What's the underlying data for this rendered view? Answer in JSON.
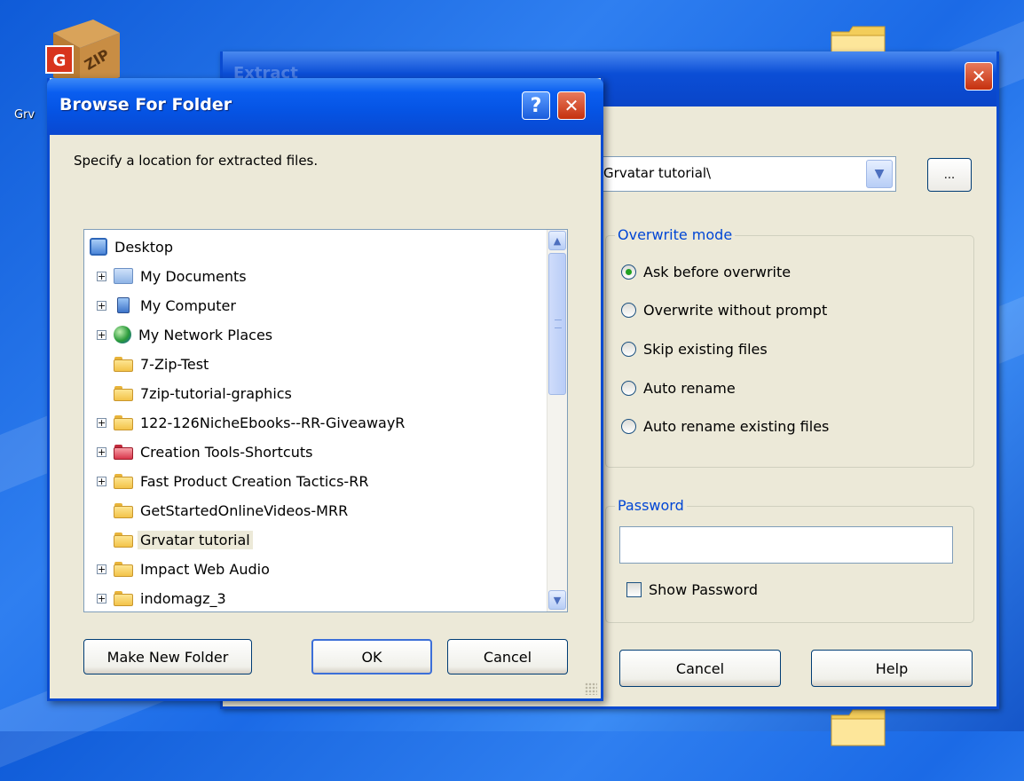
{
  "desktop": {
    "icon_label": "Grv",
    "zip_icon_text": "ZIP"
  },
  "extract_window": {
    "title": "Extract",
    "path_value": "\\Grvatar tutorial\\",
    "browse_label": "...",
    "overwrite_mode": {
      "legend": "Overwrite mode",
      "options": [
        {
          "label": "Ask before overwrite",
          "selected": true
        },
        {
          "label": "Overwrite without prompt",
          "selected": false
        },
        {
          "label": "Skip existing files",
          "selected": false
        },
        {
          "label": "Auto rename",
          "selected": false
        },
        {
          "label": "Auto rename existing files",
          "selected": false
        }
      ]
    },
    "password": {
      "legend": "Password",
      "value": "",
      "show_password_label": "Show Password",
      "show_password_checked": false
    },
    "cancel_label": "Cancel",
    "help_label": "Help"
  },
  "browse_dialog": {
    "title": "Browse For Folder",
    "help_glyph": "?",
    "prompt": "Specify a location for extracted files.",
    "tree": {
      "root": "Desktop",
      "items": [
        {
          "label": "My Documents",
          "expandable": true,
          "icon": "documents-icon"
        },
        {
          "label": "My Computer",
          "expandable": true,
          "icon": "computer-icon"
        },
        {
          "label": "My Network Places",
          "expandable": true,
          "icon": "network-icon"
        },
        {
          "label": "7-Zip-Test",
          "expandable": false,
          "icon": "folder-icon"
        },
        {
          "label": "7zip-tutorial-graphics",
          "expandable": false,
          "icon": "folder-icon"
        },
        {
          "label": "122-126NicheEbooks--RR-GiveawayR",
          "expandable": true,
          "icon": "folder-icon"
        },
        {
          "label": "Creation Tools-Shortcuts",
          "expandable": true,
          "icon": "red-folder-icon"
        },
        {
          "label": "Fast Product Creation Tactics-RR",
          "expandable": true,
          "icon": "folder-icon"
        },
        {
          "label": "GetStartedOnlineVideos-MRR",
          "expandable": false,
          "icon": "folder-icon"
        },
        {
          "label": "Grvatar tutorial",
          "expandable": false,
          "icon": "folder-icon",
          "selected": true
        },
        {
          "label": "Impact Web Audio",
          "expandable": true,
          "icon": "folder-icon"
        },
        {
          "label": "indomagz_3",
          "expandable": true,
          "icon": "folder-icon"
        }
      ]
    },
    "make_new_folder_label": "Make New Folder",
    "ok_label": "OK",
    "cancel_label": "Cancel"
  }
}
